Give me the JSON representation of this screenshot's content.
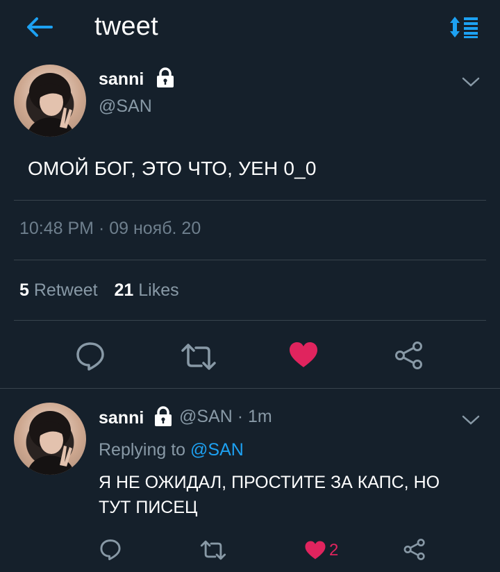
{
  "header": {
    "title": "tweet",
    "icons": {
      "back": "arrow-left-icon",
      "sort": "sort-list-icon"
    }
  },
  "main_tweet": {
    "author_name": "sanni",
    "handle": "@SAN",
    "text": "ОМОЙ БОГ, ЭТО ЧТО, УЕН 0_0",
    "timestamp": "10:48 PM · 09 нояб. 20",
    "retweets_count": "5",
    "retweets_label": "Retweet",
    "likes_count": "21",
    "likes_label": "Likes",
    "liked": true
  },
  "reply": {
    "author_name": "sanni",
    "meta": "@SAN · 1m",
    "replying_prefix": "Replying to",
    "replying_to": "@SAN",
    "text_lines": [
      "Я НЕ ОЖИДАЛ, ПРОСТИТЕ ЗА КАПС, НО",
      "ТУТ ПИСЕЦ"
    ],
    "like_count": "2",
    "liked": true
  },
  "colors": {
    "background": "#15202b",
    "accent": "#1da1f2",
    "like": "#e0245e",
    "muted_text": "#8899a6",
    "divider": "#38444d"
  }
}
